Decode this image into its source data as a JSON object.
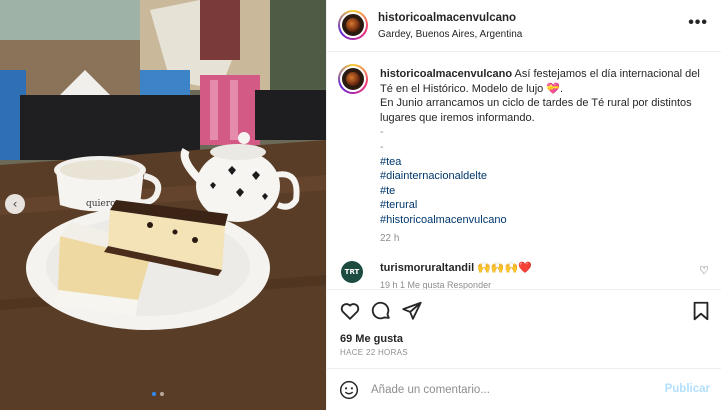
{
  "post": {
    "username": "historicoalmacenvulcano",
    "location": "Gardey, Buenos Aires, Argentina",
    "more_icon": "more-horizontal-icon"
  },
  "caption": {
    "username": "historicoalmacenvulcano",
    "line1": "Así festejamos el día internacional del Té en el Histórico. Modelo de lujo 💝.",
    "line2": "En Junio arrancamos un ciclo de tardes de Té rural por distintos lugares que iremos informando.",
    "dash1": "-",
    "dash2": "-",
    "hashtags": [
      "#tea",
      "#diainternacionaldelte",
      "#te",
      "#terural",
      "#historicoalmacenvulcano"
    ],
    "time": "22 h"
  },
  "comments": [
    {
      "avatar_text": "TRT",
      "username": "turismoruraltandil",
      "text": "🙌🙌🙌❤️",
      "partial_line": "19 h   1 Me gusta   Responder"
    }
  ],
  "actions": {
    "icons": [
      "heart-icon",
      "comment-icon",
      "share-icon",
      "bookmark-icon"
    ]
  },
  "likes": "69 Me gusta",
  "time_ago": "HACE 22 HORAS",
  "add_comment": {
    "placeholder": "Añade un comentario...",
    "publish_label": "Publicar",
    "emoji_icon": "emoji-icon"
  },
  "carousel": {
    "prev_icon": "chevron-left-icon",
    "prev_glyph": "‹",
    "slides": 2,
    "active_index": 0
  },
  "photo": {
    "mug_text": "quiero"
  },
  "colors": {
    "link": "#00376b",
    "muted": "#8e8e8e",
    "publish_disabled": "#b2dffc",
    "carousel_active": "#2f8cf0"
  }
}
